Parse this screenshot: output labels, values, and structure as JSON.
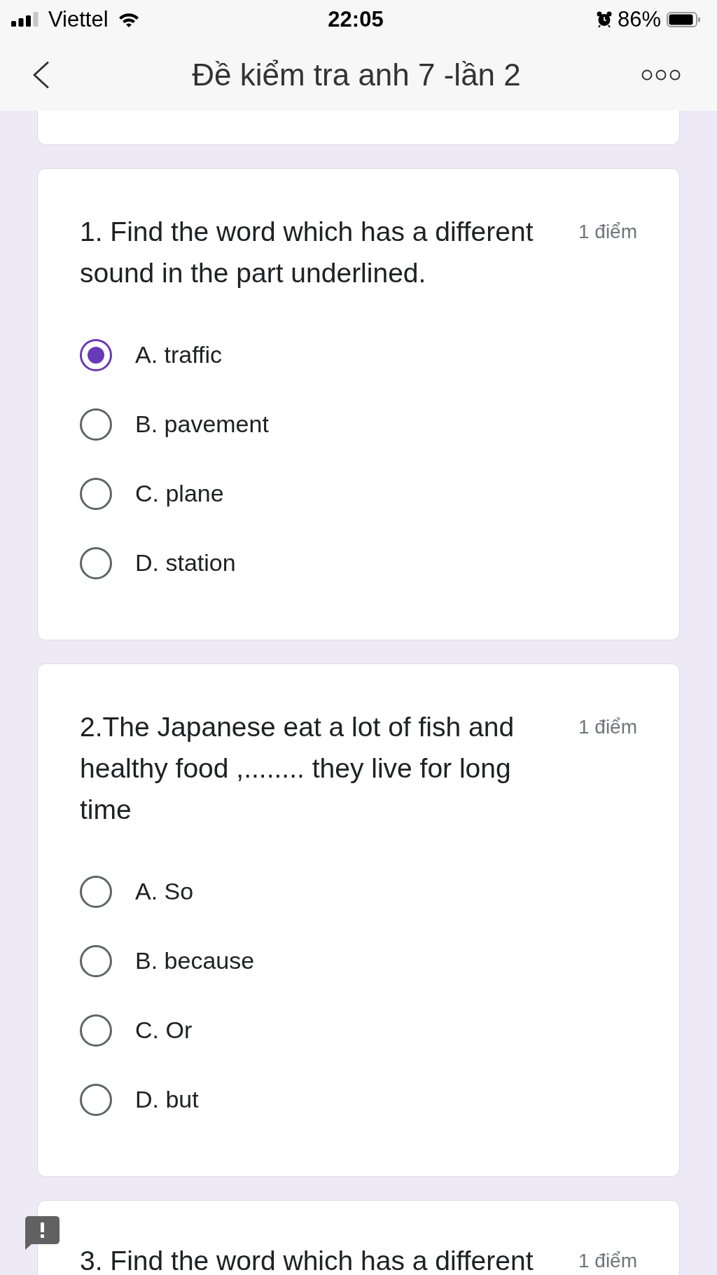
{
  "status_bar": {
    "carrier": "Viettel",
    "time": "22:05",
    "battery": "86%"
  },
  "header": {
    "title": "Đề kiểm tra anh 7 -lần 2"
  },
  "questions": [
    {
      "text": "1. Find the word which has a different sound in the part underlined.",
      "points": "1 điểm",
      "options": [
        {
          "label": "A. traffic",
          "selected": true
        },
        {
          "label": "B. pavement",
          "selected": false
        },
        {
          "label": "C. plane",
          "selected": false
        },
        {
          "label": "D. station",
          "selected": false
        }
      ]
    },
    {
      "text": "2.The Japanese eat a lot of fish and healthy food ,........ they live for long time",
      "points": "1 điểm",
      "options": [
        {
          "label": "A. So",
          "selected": false
        },
        {
          "label": "B. because",
          "selected": false
        },
        {
          "label": "C. Or",
          "selected": false
        },
        {
          "label": "D. but",
          "selected": false
        }
      ]
    },
    {
      "text": "3. Find the word which has a different",
      "points": "1 điểm"
    }
  ]
}
